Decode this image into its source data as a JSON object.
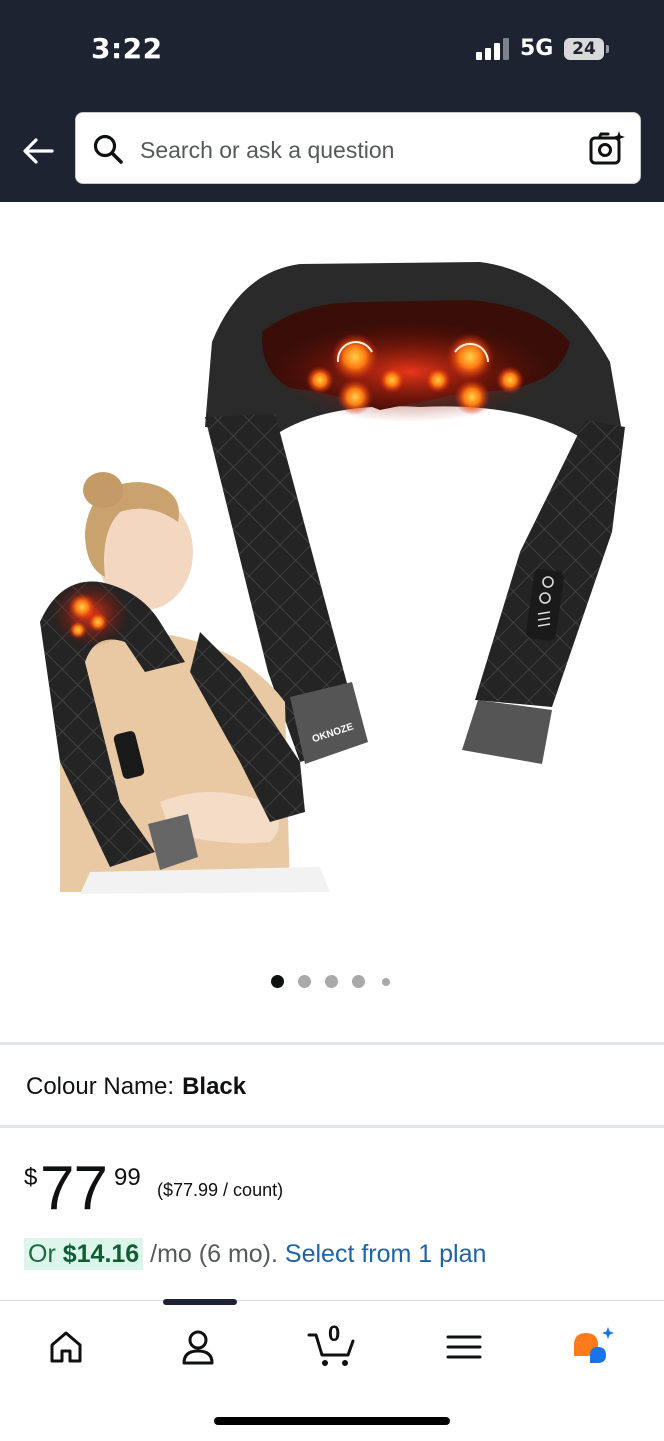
{
  "status_bar": {
    "time": "3:22",
    "network": "5G",
    "battery": "24"
  },
  "header": {
    "back_icon": "arrow-left-icon",
    "search": {
      "placeholder": "Search or ask a question",
      "value": ""
    },
    "camera_icon": "camera-sparkle-icon"
  },
  "product": {
    "image_brand_text": "OKNOZE",
    "carousel": {
      "count": 5,
      "active_index": 0
    },
    "colour": {
      "label": "Colour Name:",
      "value": "Black"
    },
    "price": {
      "symbol": "$",
      "whole": "77",
      "fraction": "99",
      "unit_price": "($77.99 / count)"
    },
    "plan": {
      "prefix": "Or",
      "amount": "$14.16",
      "period": "/mo (6 mo).",
      "link": "Select from 1 plan"
    }
  },
  "bottom_nav": {
    "items": [
      {
        "icon": "home-icon"
      },
      {
        "icon": "account-icon"
      },
      {
        "icon": "cart-icon",
        "badge": "0"
      },
      {
        "icon": "menu-icon"
      },
      {
        "icon": "rufus-assistant-icon"
      }
    ]
  },
  "colors": {
    "header_bg": "#1d2331",
    "link": "#2162a1",
    "plan_highlight": "#ddf5ea",
    "assistant_orange": "#ff7a1a",
    "assistant_blue": "#1a73e8"
  }
}
